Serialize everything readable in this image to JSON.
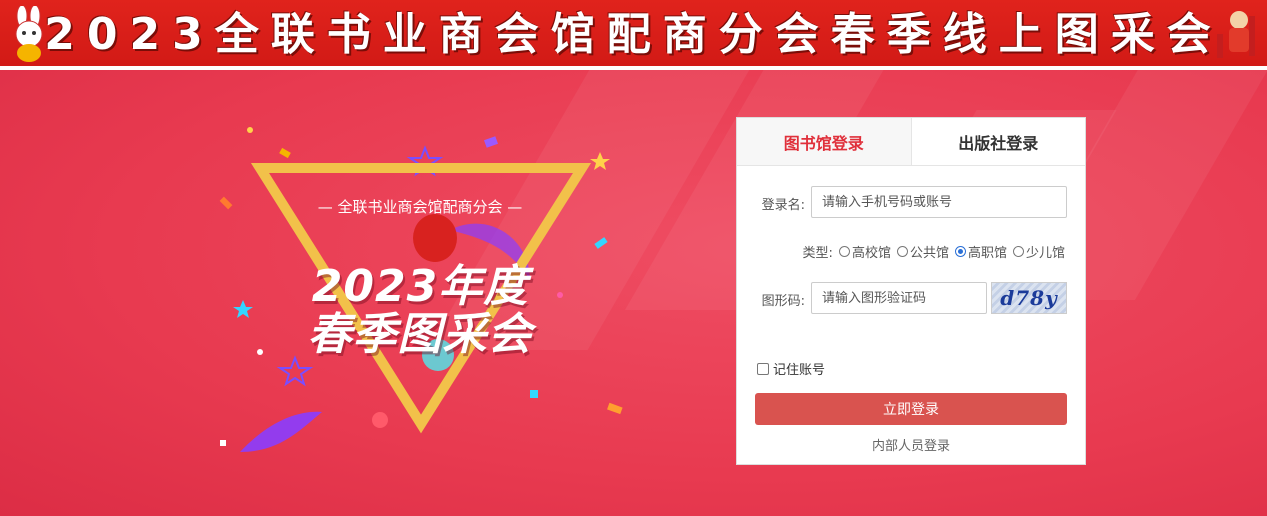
{
  "banner": {
    "title": "2023全联书业商会馆配商分会春季线上图采会"
  },
  "art": {
    "subtitle": "— 全联书业商会馆配商分会 —",
    "year_line": "2023年度",
    "title_line": "春季图采会"
  },
  "login": {
    "tabs": [
      {
        "label": "图书馆登录",
        "active": true
      },
      {
        "label": "出版社登录",
        "active": false
      }
    ],
    "username": {
      "label": "登录名:",
      "placeholder": "请输入手机号码或账号",
      "value": ""
    },
    "type": {
      "label": "类型:",
      "options": [
        {
          "label": "高校馆",
          "checked": false
        },
        {
          "label": "公共馆",
          "checked": false
        },
        {
          "label": "高职馆",
          "checked": true
        },
        {
          "label": "少儿馆",
          "checked": false
        }
      ]
    },
    "captcha": {
      "label": "图形码:",
      "placeholder": "请输入图形验证码",
      "value": "",
      "image_text": "d78y"
    },
    "remember": {
      "label": "记住账号",
      "checked": false
    },
    "submit_label": "立即登录",
    "staff_login_label": "内部人员登录"
  },
  "colors": {
    "page_background": "#e83a50",
    "banner_red": "#d21a16",
    "active_tab_text": "#e0303b",
    "login_button": "#d9534f",
    "triangle_gold": "#f2c14a"
  }
}
